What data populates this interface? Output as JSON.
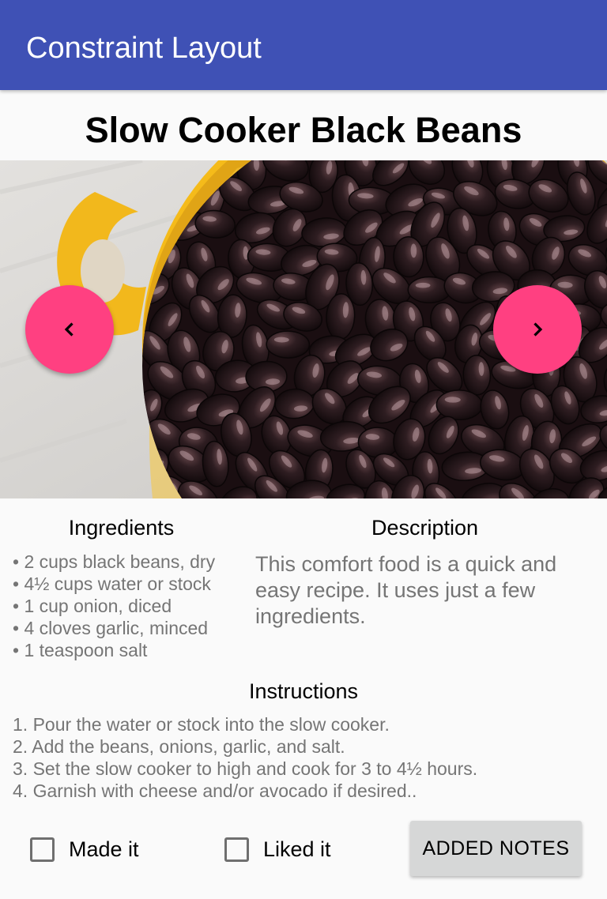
{
  "app_bar": {
    "title": "Constraint Layout",
    "color": "#3f51b5"
  },
  "recipe": {
    "title": "Slow Cooker Black Beans",
    "photo_subject": "bowl of black beans"
  },
  "navigation": {
    "prev_icon": "chevron-left-icon",
    "next_icon": "chevron-right-icon",
    "accent_color": "#ff4081"
  },
  "ingredients": {
    "heading": "Ingredients",
    "items": [
      "• 2 cups black beans, dry",
      "• 4½ cups water or stock",
      "• 1 cup onion, diced",
      "• 4 cloves garlic, minced",
      "• 1 teaspoon salt"
    ]
  },
  "description": {
    "heading": "Description",
    "text": "This comfort food is a quick and easy recipe. It uses just a few ingredients."
  },
  "instructions": {
    "heading": "Instructions",
    "steps": [
      "1. Pour the water or stock into the slow cooker.",
      "2. Add the beans, onions, garlic, and salt.",
      "3. Set the slow cooker to high and cook for 3 to 4½ hours.",
      "4. Garnish with cheese and/or avocado if desired.."
    ]
  },
  "actions": {
    "made_it_label": "Made it",
    "made_it_checked": false,
    "liked_it_label": "Liked it",
    "liked_it_checked": false,
    "notes_button_label": "ADDED NOTES"
  }
}
